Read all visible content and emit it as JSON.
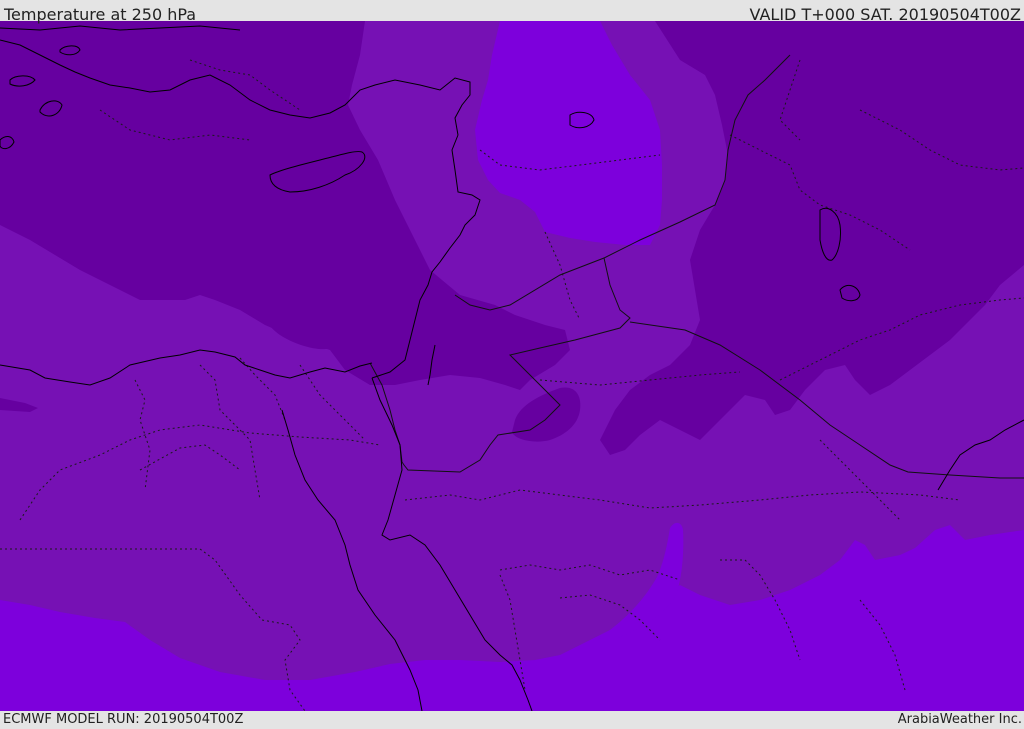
{
  "header": {
    "title": "Temperature at 250 hPa",
    "valid": "VALID T+000 SAT. 20190504T00Z"
  },
  "footer": {
    "model_run": "ECMWF MODEL RUN: 20190504T00Z",
    "credit": "ArabiaWeather Inc."
  },
  "colors": {
    "band_cold": "#6600a0",
    "band_mid": "#7611b4",
    "band_warm": "#7d00dc",
    "coastline": "#000000",
    "border": "#1a1a1a"
  },
  "map": {
    "field": "temperature",
    "level": "250 hPa"
  }
}
